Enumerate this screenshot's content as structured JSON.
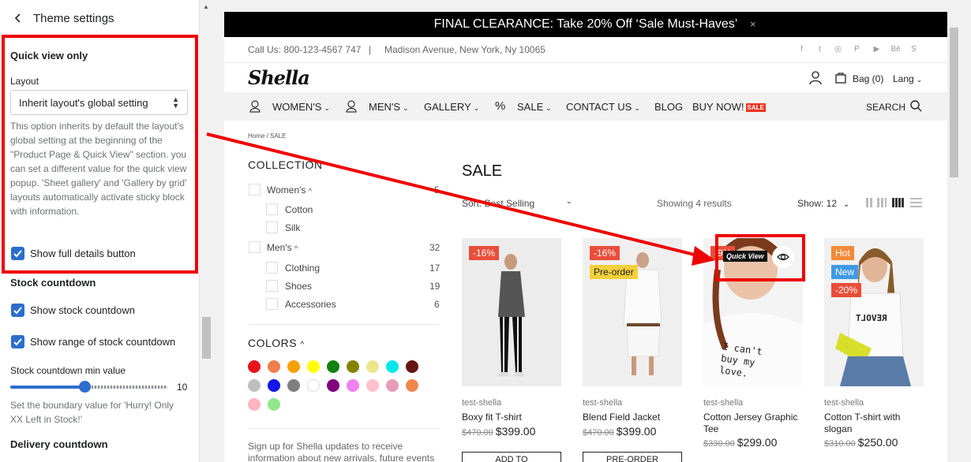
{
  "panel": {
    "title": "Theme settings",
    "quick_view": {
      "heading": "Quick view only",
      "layout_label": "Layout",
      "layout_value": "Inherit layout's global setting",
      "layout_help": "This option inherits by default the layout's global setting at the beginning of the \"Product Page & Quick View\" section. you can set a different value for the quick view popup. 'Sheet gallery' and 'Gallery by grid' layouts automatically activate sticky block with information.",
      "show_full_details": "Show full details button"
    },
    "stock": {
      "heading": "Stock countdown",
      "show_stock": "Show stock countdown",
      "show_range": "Show range of stock countdown",
      "min_label": "Stock countdown min value",
      "min_value": "10",
      "min_fraction": 0.47,
      "min_help": "Set the boundary value for 'Hurry! Only XX Left in Stock!'"
    },
    "delivery": {
      "heading": "Delivery countdown"
    }
  },
  "store": {
    "promo": "FINAL CLEARANCE: Take 20% Off ‘Sale Must-Haves’",
    "promo_close": "×",
    "phone": "Call Us: 800-123-4567 747",
    "separator": "|",
    "address": "Madison Avenue, New York, Ny 10065",
    "logo": "Shella",
    "bag": "Bag (0)",
    "lang": "Lang",
    "nav": [
      "WOMEN'S",
      "MEN'S",
      "GALLERY",
      "SALE",
      "CONTACT US",
      "BLOG",
      "BUY NOW!"
    ],
    "nav_badge": "SALE",
    "search": "SEARCH",
    "breadcrumb": "Home  /  SALE",
    "collection": "COLLECTION",
    "filters": {
      "women": "Women's",
      "women_count": "5",
      "cotton": "Cotton",
      "silk": "Silk",
      "men": "Men's",
      "men_count": "32",
      "clothing": "Clothing",
      "clothing_count": "17",
      "shoes": "Shoes",
      "shoes_count": "19",
      "accessories": "Accessories",
      "accessories_count": "6"
    },
    "colors_title": "COLORS",
    "colors": [
      "#e8141b",
      "#f07d4c",
      "#f6a10a",
      "#ffff00",
      "#138012",
      "#838300",
      "#ede68e",
      "#00e8e8",
      "#641412",
      "#bfbfbf",
      "#1515e8",
      "#7f7f7f",
      "#ffffff",
      "#800080",
      "#ee82ee",
      "#ffc0cb",
      "#e89cb8",
      "#f0884e",
      "#ffb5c0",
      "#90e888"
    ],
    "signup": "Sign up for Shella updates to receive information about new arrivals, future events and specials.",
    "sale_title": "SALE",
    "sort": "Sort: Best Selling",
    "showing": "Showing 4 results",
    "show": "Show:  12",
    "quick_view_tooltip": "Quick View",
    "products": [
      {
        "vendor": "test-shella",
        "name": "Boxy fit T-shirt",
        "old_price": "$470.00",
        "price": "$399.00",
        "badges": [
          "-16%"
        ],
        "button": "ADD TO"
      },
      {
        "vendor": "test-shella",
        "name": "Blend Field Jacket",
        "old_price": "$470.00",
        "price": "$399.00",
        "badges": [
          "-16%",
          "Pre-order"
        ],
        "button": "PRE-ORDER"
      },
      {
        "vendor": "test-shella",
        "name": "Cotton Jersey Graphic Tee",
        "old_price": "$330.00",
        "price": "$299.00",
        "badges": [
          "-9%"
        ],
        "shirt_text": "I can't buy my love.",
        "button": ""
      },
      {
        "vendor": "test-shella",
        "name": "Cotton T-shirt with slogan",
        "old_price": "$310.00",
        "price": "$250.00",
        "badges": [
          "Hot",
          "New",
          "-20%"
        ],
        "shirt_text": "REVOLT",
        "button": ""
      }
    ]
  },
  "colors": {
    "accent": "#2c6ecb",
    "highlight": "#ee0000",
    "badge_red": "#e94e3a",
    "badge_yellow": "#f5d03c",
    "badge_orange": "#f28a3a",
    "badge_blue": "#3f9ae6"
  }
}
